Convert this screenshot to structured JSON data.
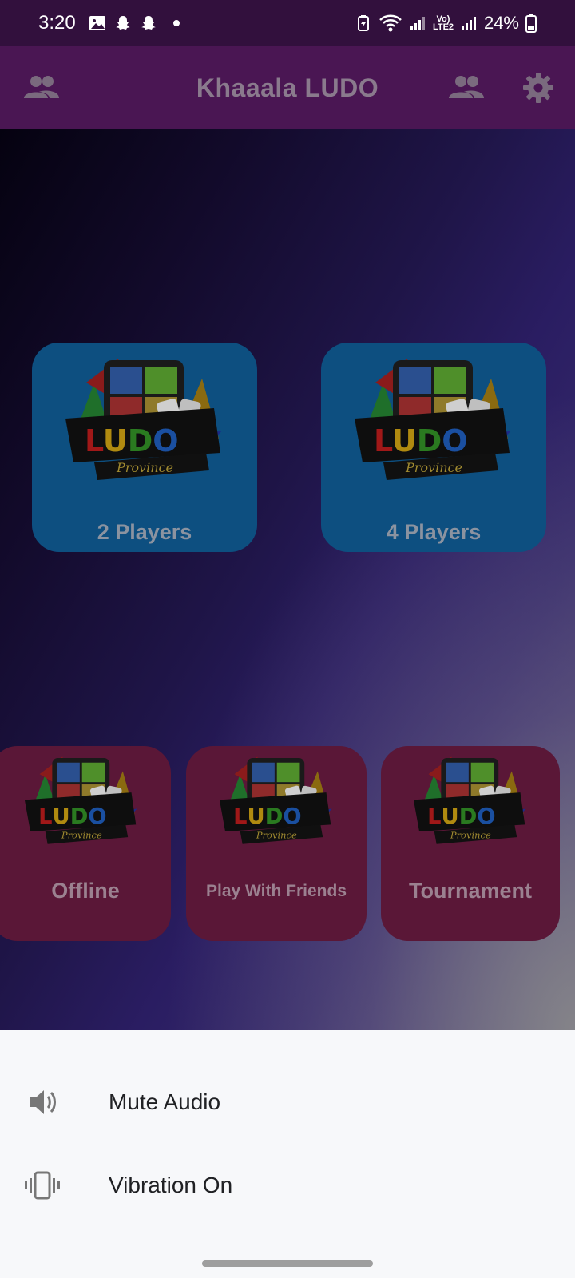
{
  "status_bar": {
    "time": "3:20",
    "battery": "24%",
    "network_label": "Vo) LTE2",
    "icons": [
      "gallery-icon",
      "snapchat-icon",
      "snapchat-icon",
      "dot-icon",
      "battery-saver-icon",
      "wifi-icon",
      "signal-icon",
      "signal-icon",
      "battery-icon"
    ]
  },
  "app_bar": {
    "title": "Khaaala LUDO",
    "left_icon": "people-icon",
    "right_icons": [
      "people-icon",
      "gear-icon"
    ]
  },
  "modes_top": [
    {
      "label": "2 Players",
      "logo_text": "LUDO",
      "logo_sub": "Province"
    },
    {
      "label": "4 Players",
      "logo_text": "LUDO",
      "logo_sub": "Province"
    }
  ],
  "modes_bottom": [
    {
      "label": "Offline",
      "logo_text": "LUDO",
      "logo_sub": "Province"
    },
    {
      "label": "Play With Friends",
      "logo_text": "LUDO",
      "logo_sub": "Province"
    },
    {
      "label": "Tournament",
      "logo_text": "LUDO",
      "logo_sub": "Province"
    }
  ],
  "sheet": {
    "items": [
      {
        "label": "Mute Audio",
        "icon": "speaker-icon"
      },
      {
        "label": "Vibration On",
        "icon": "vibration-icon"
      }
    ]
  },
  "colors": {
    "status_bar": "#32103d",
    "app_bar": "#4a1653",
    "tile_blue": "#0d4f80",
    "tile_pink": "#5a1737",
    "sheet": "#f7f8fa"
  }
}
